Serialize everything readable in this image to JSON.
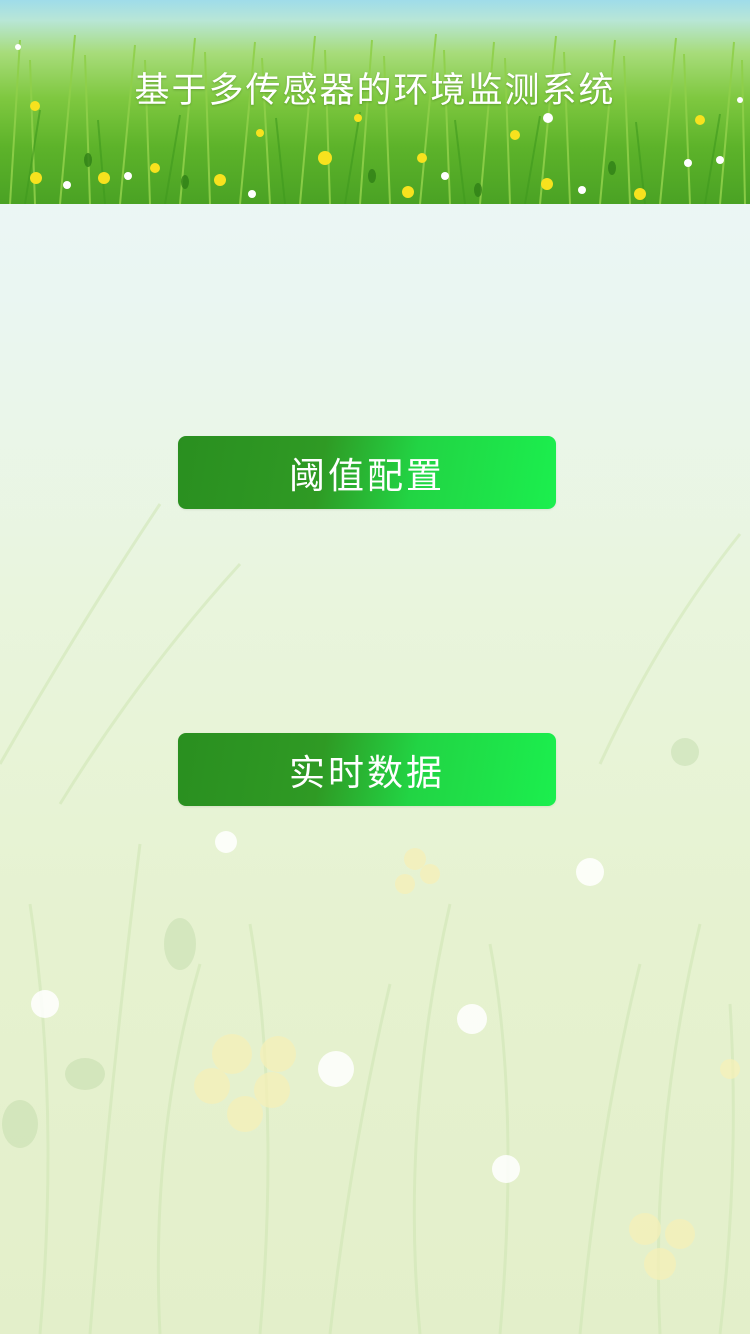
{
  "header": {
    "title": "基于多传感器的环境监测系统"
  },
  "buttons": {
    "threshold_config": "阈值配置",
    "realtime_data": "实时数据"
  },
  "colors": {
    "button_start": "#2a8f20",
    "button_end": "#1bef4e",
    "header_grass": "#5db32a",
    "sky": "#9fdcea",
    "text": "#ffffff"
  }
}
